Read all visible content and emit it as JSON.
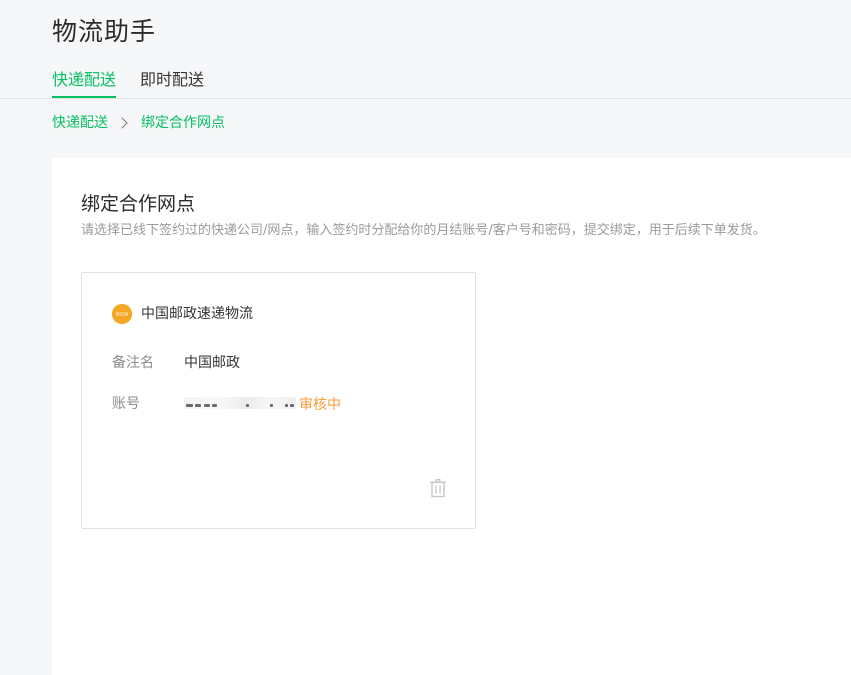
{
  "app": {
    "title": "物流助手"
  },
  "tabs": [
    {
      "label": "快递配送",
      "active": true
    },
    {
      "label": "即时配送",
      "active": false
    }
  ],
  "breadcrumb": {
    "parent": "快递配送",
    "current": "绑定合作网点"
  },
  "section": {
    "title": "绑定合作网点",
    "description": "请选择已线下签约过的快递公司/网点，输入签约时分配给你的月结账号/客户号和密码，提交绑定，用于后续下单发货。"
  },
  "card": {
    "carrier_logo_icon": "china-post-logo",
    "carrier_logo_color": "#f5a623",
    "carrier_name": "中国邮政速递物流",
    "remark_label": "备注名",
    "remark_value": "中国邮政",
    "account_label": "账号",
    "status": "审核中",
    "status_color": "#fa9d3b",
    "delete_icon": "trash-icon"
  },
  "colors": {
    "accent": "#07c160",
    "background": "#f6f7f9",
    "panel": "#ffffff"
  }
}
